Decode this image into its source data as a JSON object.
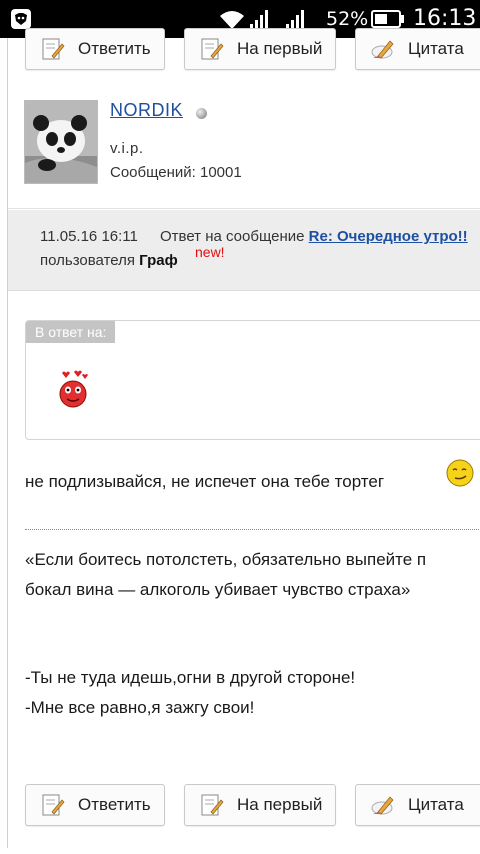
{
  "status_bar": {
    "battery_percent": "52%",
    "time": "16:13"
  },
  "buttons": {
    "reply": "Ответить",
    "to_first": "На первый",
    "quote": "Цитата"
  },
  "profile": {
    "username": "NORDIK",
    "rank": "v.i.p.",
    "posts": "Сообщений: 10001"
  },
  "meta": {
    "datetime": "11.05.16 16:11",
    "reply_prefix": "Ответ на сообщение",
    "reply_link": "Re: Очередное утро!!",
    "user_prefix": "пользователя",
    "user_name": "Граф",
    "new_badge": "new!"
  },
  "quote": {
    "label": "В ответ на:"
  },
  "message": {
    "line1": "не подлизывайся, не испечет она тебе тортег",
    "line2": "«Если боитесь потолстеть, обязательно выпейте п",
    "line3": "бокал вина — алкоголь убивает чувство страха»",
    "line4": "-Ты не туда идешь,огни в другой стороне!",
    "line5": "-Мне все равно,я зажгу свои!"
  }
}
